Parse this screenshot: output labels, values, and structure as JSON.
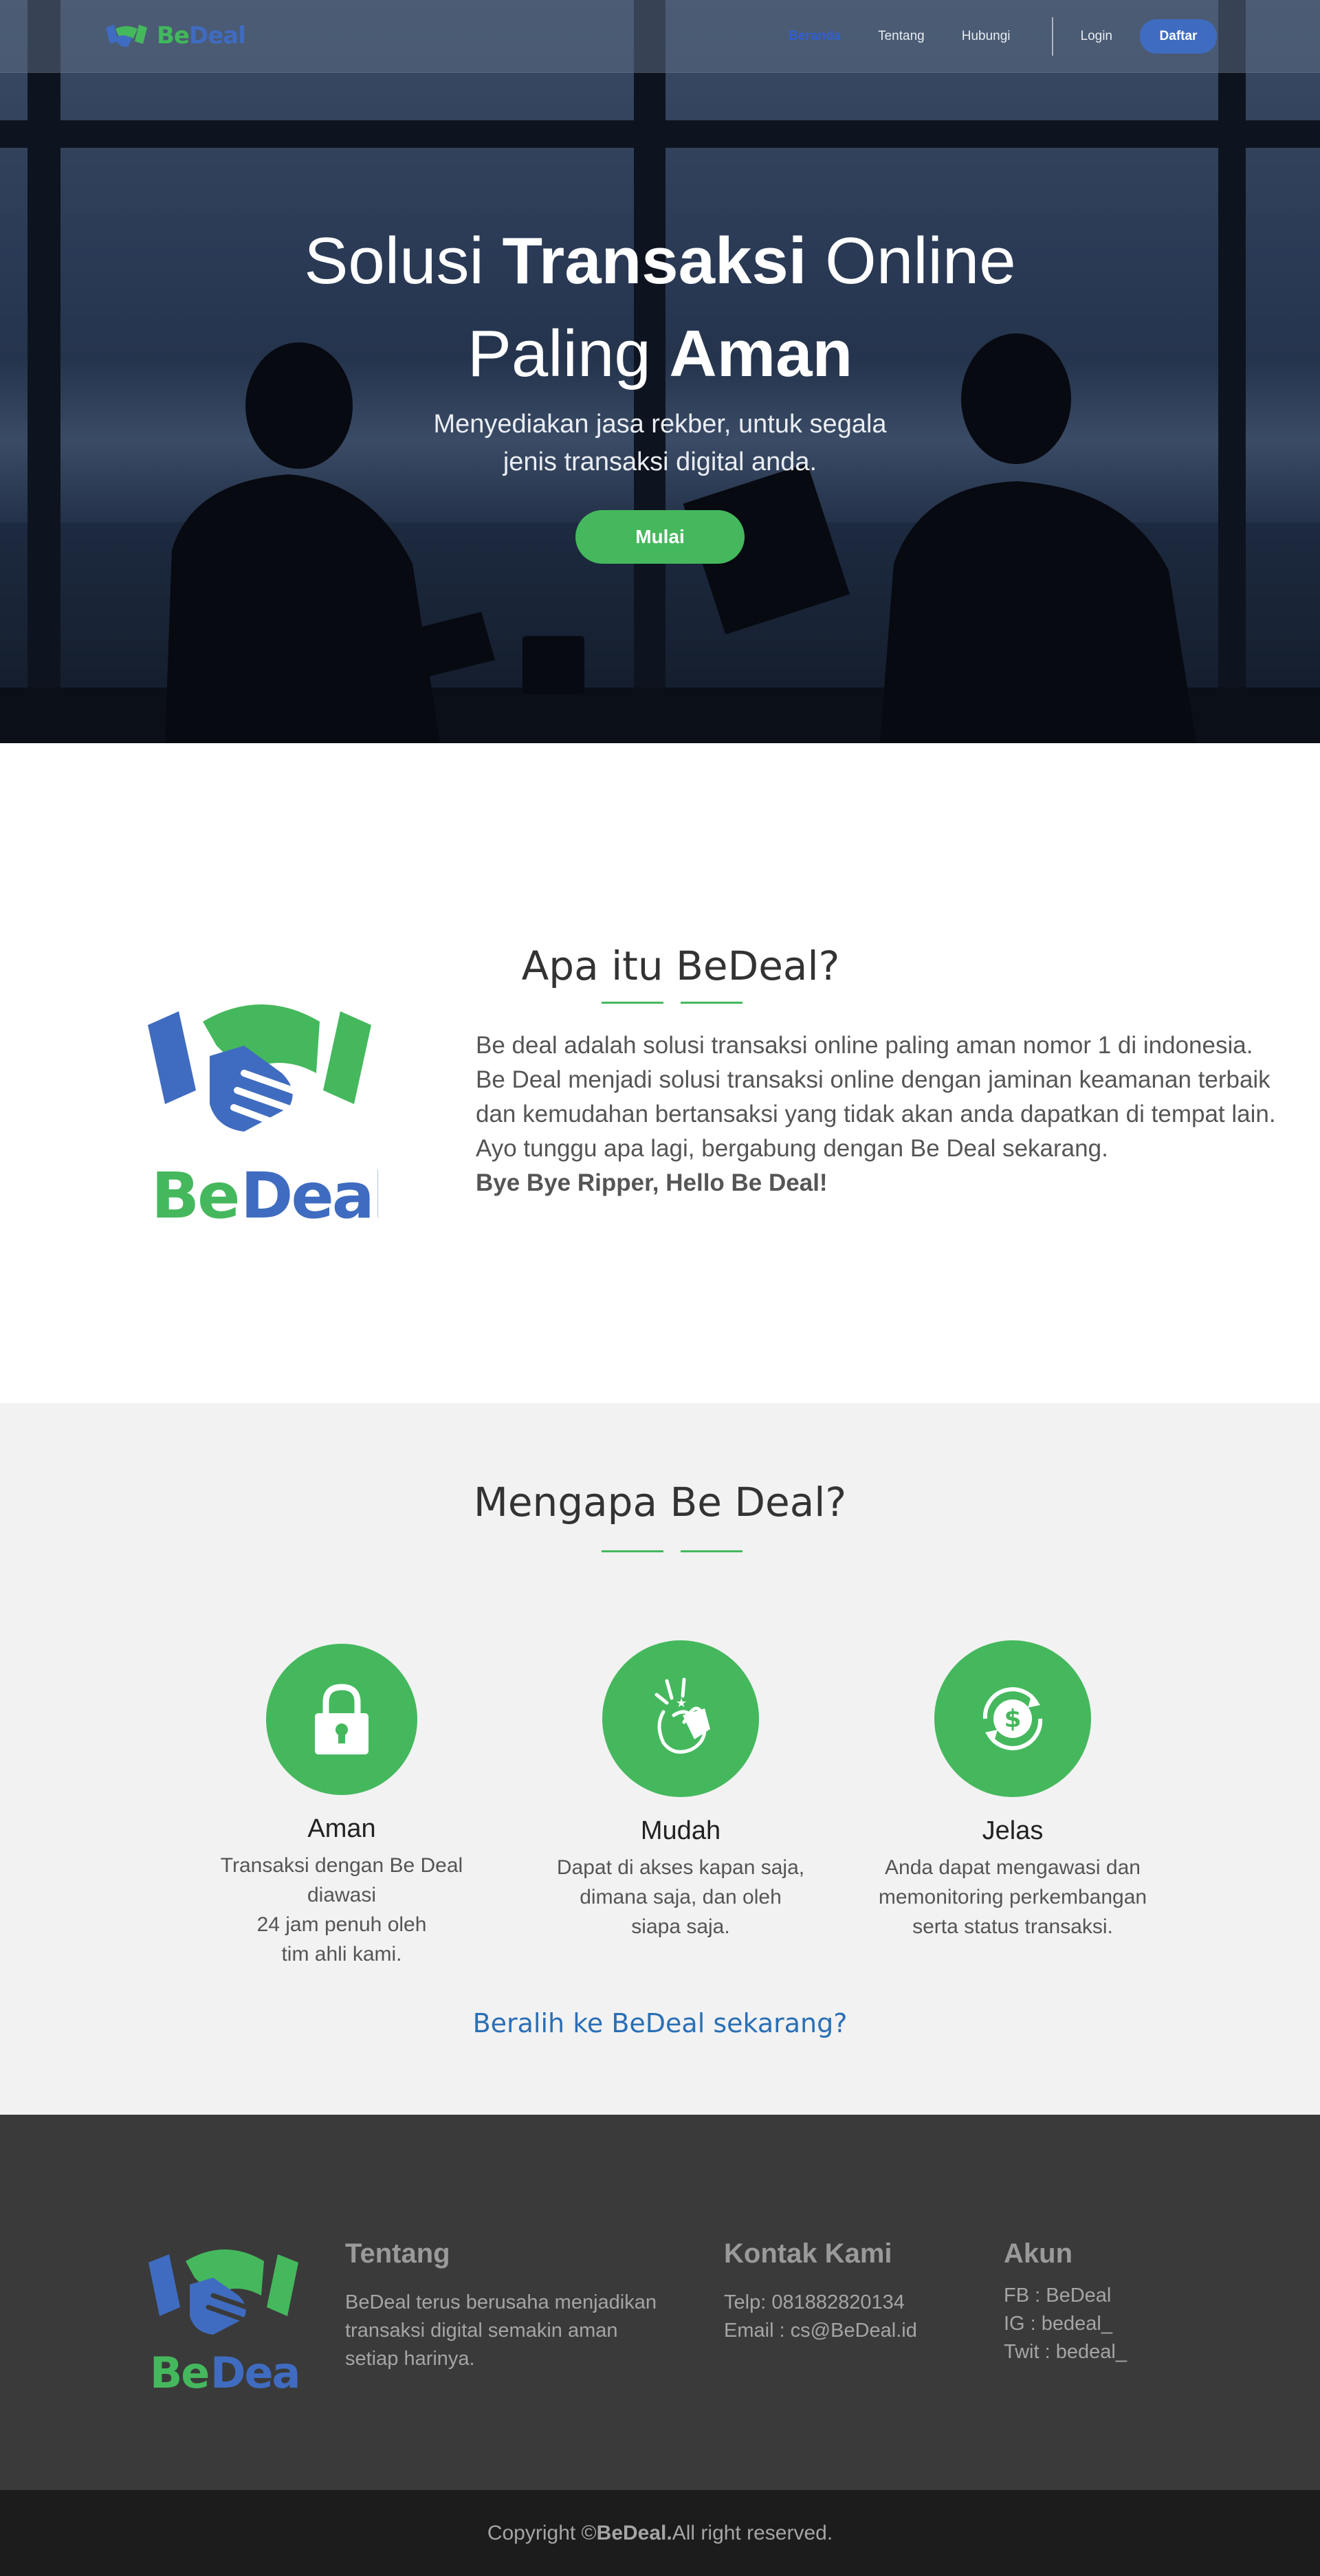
{
  "brand": {
    "be": "Be",
    "deal": "Deal",
    "green": "#45b85d",
    "blue": "#3f6cc0"
  },
  "nav": {
    "items": [
      {
        "label": "Beranda",
        "active": true
      },
      {
        "label": "Tentang",
        "active": false
      },
      {
        "label": "Hubungi",
        "active": false
      }
    ],
    "login": "Login",
    "signup": "Daftar"
  },
  "hero": {
    "title_part1": "Solusi ",
    "title_bold1": "Transaksi",
    "title_part2": " Online",
    "title_part3": "Paling ",
    "title_bold2": "Aman",
    "subtitle_line1": "Menyediakan jasa rekber, untuk segala",
    "subtitle_line2": "jenis transaksi digital anda.",
    "cta": "Mulai"
  },
  "about": {
    "title": "Apa itu BeDeal?",
    "lines": [
      "Be deal adalah solusi transaksi online paling aman nomor 1 di indonesia.",
      "Be Deal menjadi solusi transaksi online dengan jaminan keamanan terbaik",
      "dan kemudahan bertansaksi yang tidak akan anda dapatkan di tempat lain.",
      "Ayo tunggu apa lagi, bergabung dengan Be Deal sekarang."
    ],
    "tagline": "Bye Bye Ripper, Hello Be Deal!"
  },
  "why": {
    "title": "Mengapa Be Deal?",
    "features": [
      {
        "icon": "lock-icon",
        "title": "Aman",
        "text": "Transaksi dengan Be Deal diawasi\n24 jam penuh oleh\ntim ahli kami."
      },
      {
        "icon": "finger-snap-icon",
        "title": "Mudah",
        "text": "Dapat di akses kapan saja,\ndimana saja, dan oleh\nsiapa saja."
      },
      {
        "icon": "dollar-cycle-icon",
        "title": "Jelas",
        "text": "Anda dapat mengawasi dan\nmemonitoring perkembangan\nserta status transaksi."
      }
    ],
    "cta": "Beralih ke BeDeal sekarang?"
  },
  "footer": {
    "about_title": "Tentang",
    "about_text": "BeDeal terus berusaha menjadikan\ntransaksi  digital semakin aman\nsetiap harinya.",
    "contact_title": "Kontak Kami",
    "contact_text": "Telp: 081882820134\nEmail : cs@BeDeal.id",
    "account_title": "Akun",
    "account_text": "FB : BeDeal\nIG : bedeal_\nTwit : bedeal_",
    "copyright_prefix": "Copyright ©",
    "copyright_brand": "BeDeal.",
    "copyright_suffix": " All right reserved."
  }
}
